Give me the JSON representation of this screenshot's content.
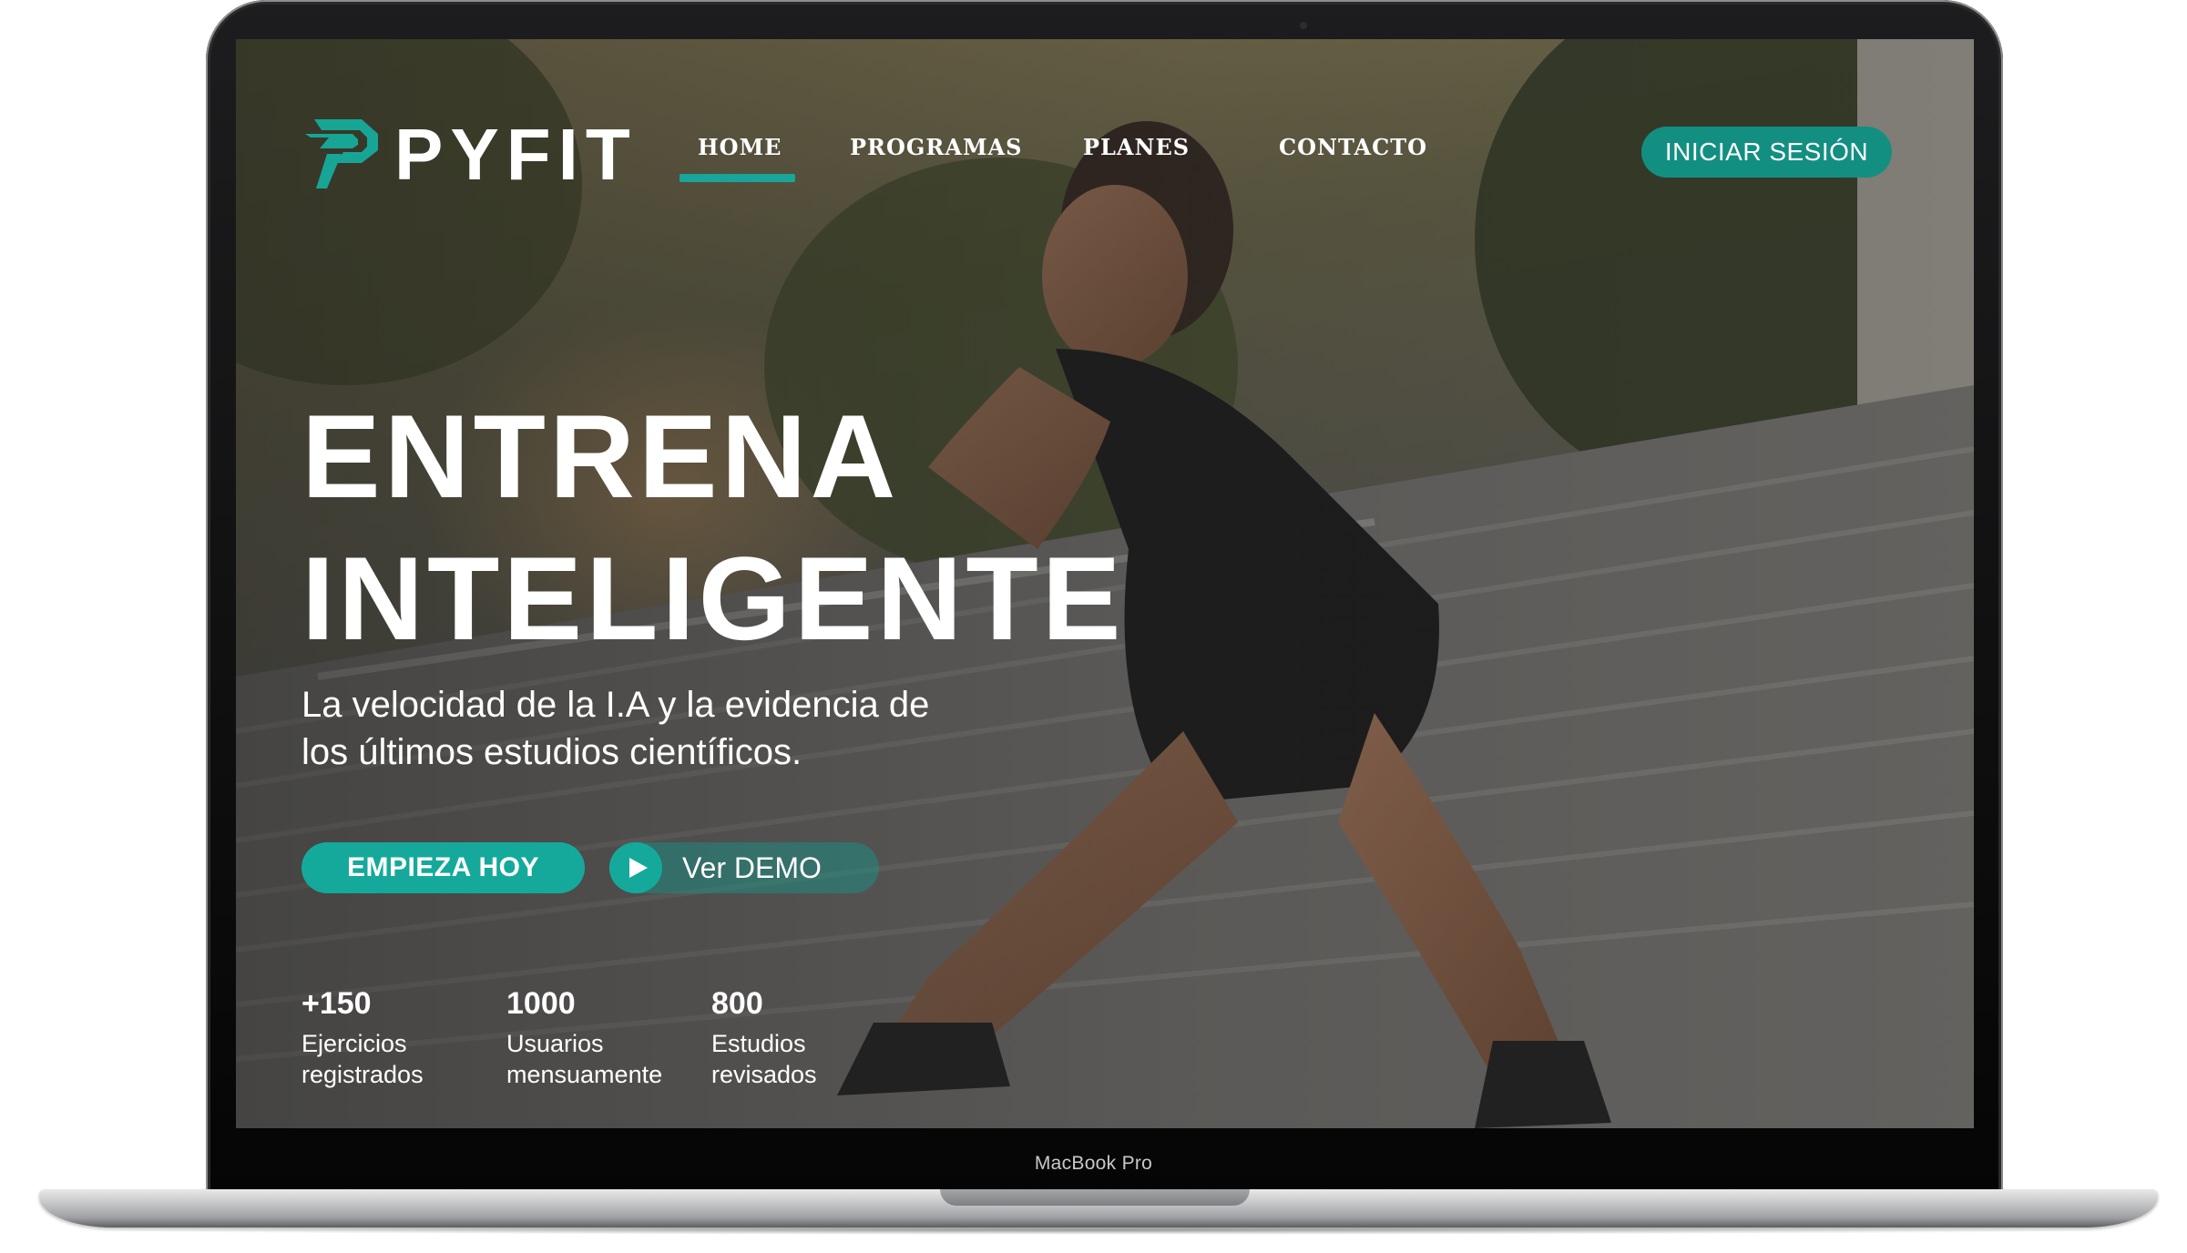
{
  "device": {
    "brand_label": "MacBook Pro"
  },
  "site": {
    "logo_text": "PYFIT",
    "nav": [
      {
        "label": "HOME",
        "active": true
      },
      {
        "label": "PROGRAMAS"
      },
      {
        "label": "PLANES"
      },
      {
        "label": "CONTACTO"
      }
    ],
    "login_label": "INICIAR SESIÓN"
  },
  "hero": {
    "title_line1": "ENTRENA",
    "title_line2": "INTELIGENTE",
    "subtitle_line1": "La velocidad de la I.A y la evidencia de",
    "subtitle_line2": "los últimos estudios científicos.",
    "cta_primary": "EMPIEZA HOY",
    "cta_demo": "Ver DEMO",
    "image": "woman-stretching-on-stairs-photo"
  },
  "stats": [
    {
      "value": "+150",
      "label": "Ejercicios\nregistrados"
    },
    {
      "value": "1000",
      "label": "Usuarios\nmensuamente"
    },
    {
      "value": "800",
      "label": "Estudios\nrevisados"
    }
  ],
  "colors": {
    "accent": "#15a99b",
    "accent_dark": "#138f82",
    "text": "#ffffff",
    "frame": "#0b0b0c",
    "base": "#c4c5c7"
  }
}
